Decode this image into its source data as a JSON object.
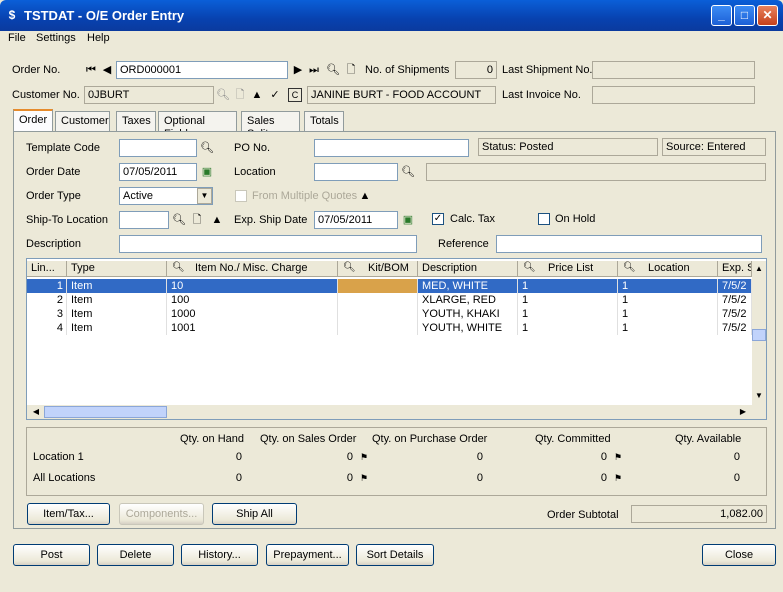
{
  "window": {
    "title": "TSTDAT - O/E Order Entry",
    "min": "_",
    "max": "□",
    "close": "✕"
  },
  "menu": [
    "File",
    "Settings",
    "Help"
  ],
  "header": {
    "order_no_label": "Order No.",
    "order_no": "ORD000001",
    "shipments_label": "No. of Shipments",
    "shipments": "0",
    "last_shipment_label": "Last Shipment No.",
    "last_shipment": "",
    "customer_no_label": "Customer No.",
    "customer_no": "0JBURT",
    "customer_name": "JANINE BURT - FOOD ACCOUNT",
    "last_invoice_label": "Last Invoice No.",
    "last_invoice": ""
  },
  "tabs": [
    "Order",
    "Customer",
    "Taxes",
    "Optional Fields",
    "Sales Split",
    "Totals"
  ],
  "form": {
    "template_code_label": "Template Code",
    "template_code": "",
    "po_no_label": "PO No.",
    "po_no": "",
    "status": "Status: Posted",
    "source": "Source: Entered",
    "order_date_label": "Order Date",
    "order_date": "07/05/2011",
    "location_label": "Location",
    "location": "",
    "location_desc": "",
    "order_type_label": "Order Type",
    "order_type": "Active",
    "from_quotes_label": "From Multiple Quotes",
    "ship_to_label": "Ship-To Location",
    "ship_to": "",
    "exp_ship_label": "Exp. Ship Date",
    "exp_ship": "07/05/2011",
    "calc_tax_label": "Calc. Tax",
    "on_hold_label": "On Hold",
    "description_label": "Description",
    "description": "",
    "reference_label": "Reference",
    "reference": ""
  },
  "grid": {
    "columns": [
      "Lin...",
      "Type",
      "Item No./ Misc. Charge",
      "Kit/BOM",
      "Description",
      "Price List",
      "Location",
      "Exp. S"
    ],
    "rows": [
      {
        "line": "1",
        "type": "Item",
        "item": "10",
        "kit": "",
        "desc": "MED, WHITE",
        "price": "1",
        "loc": "1",
        "exp": "7/5/2"
      },
      {
        "line": "2",
        "type": "Item",
        "item": "100",
        "kit": "",
        "desc": "XLARGE, RED",
        "price": "1",
        "loc": "1",
        "exp": "7/5/2"
      },
      {
        "line": "3",
        "type": "Item",
        "item": "1000",
        "kit": "",
        "desc": "YOUTH, KHAKI",
        "price": "1",
        "loc": "1",
        "exp": "7/5/2"
      },
      {
        "line": "4",
        "type": "Item",
        "item": "1001",
        "kit": "",
        "desc": "YOUTH, WHITE",
        "price": "1",
        "loc": "1",
        "exp": "7/5/2"
      }
    ],
    "selected_highlight": "#316ac5",
    "kit_highlight": "#d9a24a"
  },
  "qty": {
    "headers": [
      "Qty. on Hand",
      "Qty. on Sales Order",
      "Qty. on Purchase Order",
      "Qty. Committed",
      "Qty. Available"
    ],
    "location_label": "Location  1",
    "location_vals": [
      "0",
      "0",
      "0",
      "0",
      "0"
    ],
    "all_label": "All Locations",
    "all_vals": [
      "0",
      "0",
      "0",
      "0",
      "0"
    ]
  },
  "buttons": {
    "item_tax": "Item/Tax...",
    "components": "Components...",
    "ship_all": "Ship All",
    "post": "Post",
    "delete": "Delete",
    "history": "History...",
    "prepayment": "Prepayment...",
    "sort_details": "Sort Details",
    "close": "Close"
  },
  "subtotal_label": "Order Subtotal",
  "subtotal": "1,082.00"
}
